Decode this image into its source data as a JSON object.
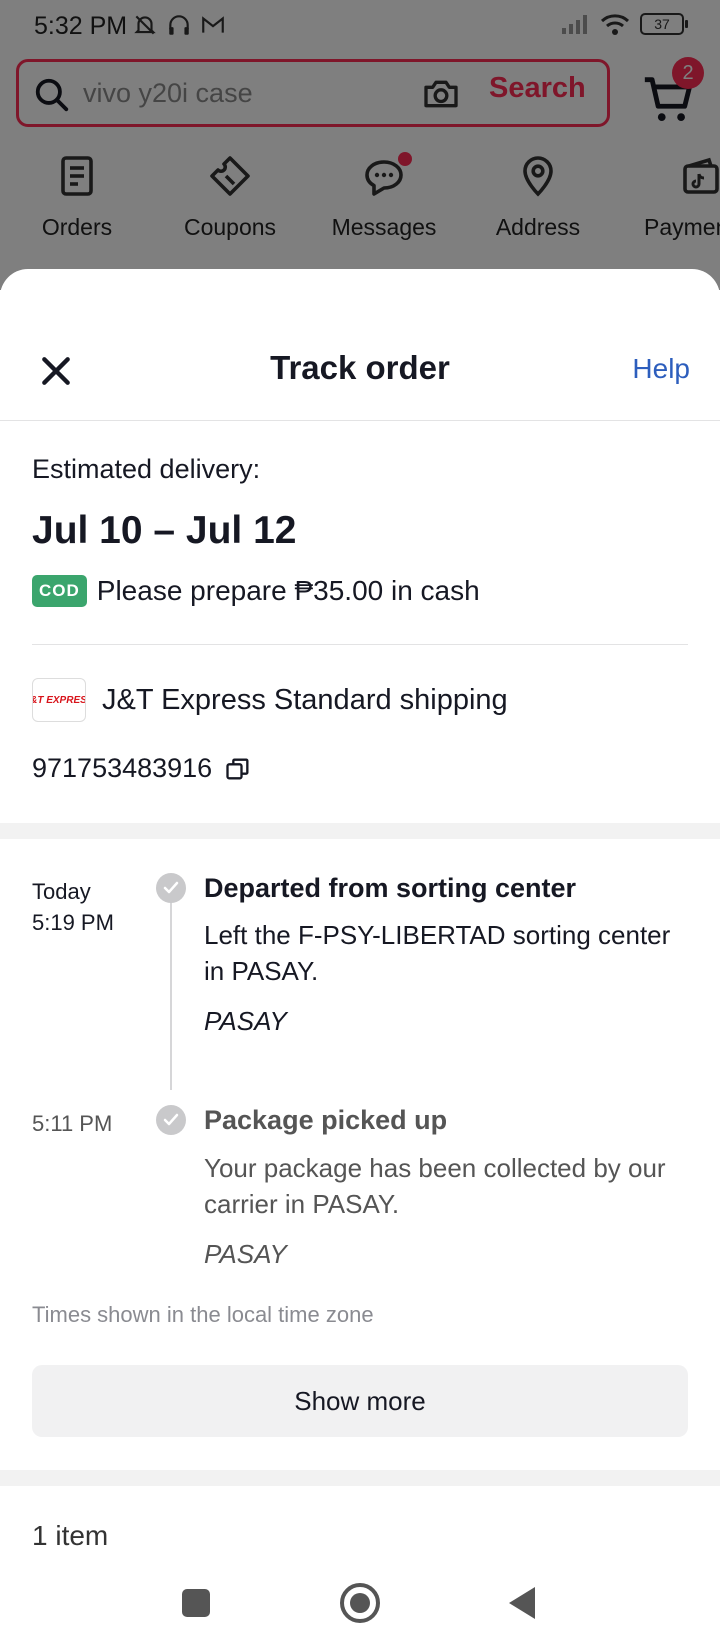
{
  "status_bar": {
    "time": "5:32 PM",
    "battery": "37"
  },
  "search": {
    "placeholder": "vivo y20i case",
    "button_label": "Search"
  },
  "cart": {
    "badge_count": "2"
  },
  "quick_nav": {
    "items": [
      {
        "label": "Orders",
        "icon": "orders-icon"
      },
      {
        "label": "Coupons",
        "icon": "coupon-icon"
      },
      {
        "label": "Messages",
        "icon": "message-icon"
      },
      {
        "label": "Address",
        "icon": "location-pin-icon"
      },
      {
        "label": "Paymen",
        "icon": "wallet-icon"
      }
    ]
  },
  "sheet": {
    "title": "Track order",
    "help_label": "Help",
    "estimated_label": "Estimated delivery:",
    "estimated_date": "Jul 10 – Jul 12",
    "cod_badge": "COD",
    "cod_text": "Please prepare ₱35.00 in cash",
    "carrier_logo_text": "J&T EXPRESS",
    "carrier_name": "J&T Express Standard shipping",
    "tracking_number": "971753483916",
    "events": [
      {
        "day": "Today",
        "time": "5:19 PM",
        "title": "Departed from sorting center",
        "description": "Left the F-PSY-LIBERTAD sorting center in PASAY.",
        "location": "PASAY"
      },
      {
        "day": "",
        "time": "5:11 PM",
        "title": "Package picked up",
        "description": "Your package has been collected by our carrier in PASAY.",
        "location": "PASAY"
      }
    ],
    "timezone_note": "Times shown in the local time zone",
    "show_more_label": "Show more",
    "items_count": "1 item"
  },
  "colors": {
    "brand_red": "#fe2c55",
    "link_blue": "#2d5ebd",
    "cod_green": "#3ba56d"
  }
}
